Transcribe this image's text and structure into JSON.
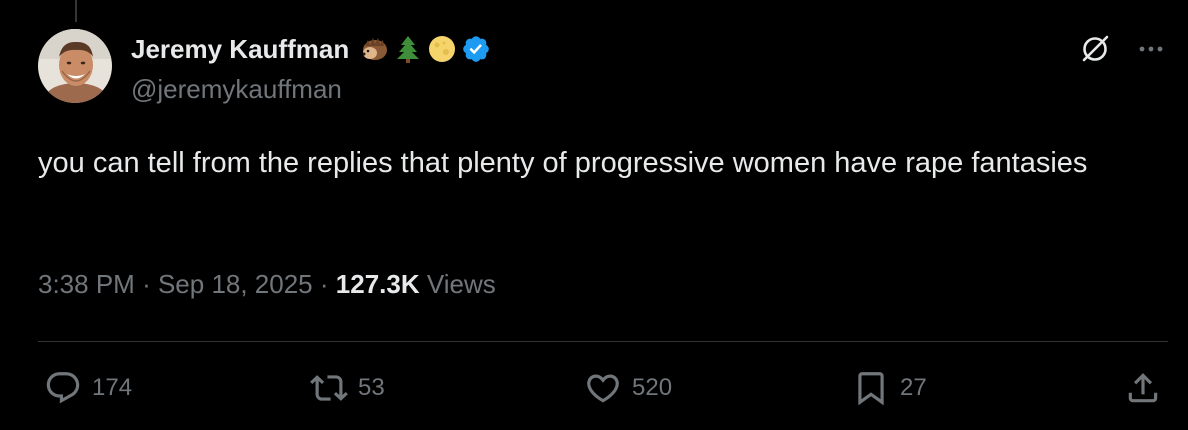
{
  "author": {
    "display_name": "Jeremy Kauffman",
    "name_emojis": [
      "hedgehog-emoji",
      "evergreen-tree-emoji",
      "full-moon-emoji"
    ],
    "verified": true,
    "handle": "@jeremykauffman"
  },
  "tweet": {
    "text": "you can tell from the replies that plenty of progressive women have rape fantasies",
    "time": "3:38 PM",
    "date": "Sep 18, 2025",
    "separator": "·",
    "views_count": "127.3K",
    "views_label": "Views"
  },
  "actions": {
    "replies": "174",
    "reposts": "53",
    "likes": "520",
    "bookmarks": "27"
  },
  "icons": {
    "top_right": [
      "grok-icon",
      "more-icon"
    ],
    "action_bar": [
      "reply-icon",
      "repost-icon",
      "like-icon",
      "bookmark-icon",
      "share-icon"
    ]
  },
  "colors": {
    "background": "#000000",
    "text_primary": "#e7e9ea",
    "text_secondary": "#71767b",
    "verified_blue": "#1d9bf0",
    "divider": "#2f3336"
  }
}
